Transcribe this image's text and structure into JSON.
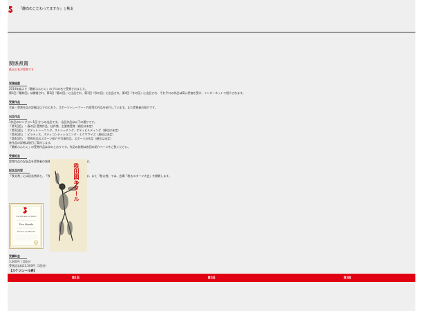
{
  "header": {
    "logo_icon": "brand-logo-icon",
    "title": "「趣向のこだわってますか」 | 秩太"
  },
  "main": {
    "title": "関係県賞",
    "subtitle": "秩太の名が受賞です",
    "sections": [
      {
        "heading": "受賞経歴",
        "lines": [
          "2014年度より『最新ぶんもく』のプロの名で受賞されました。",
          "第1回『最終回』は開催され、第2回『春の回』に出品され、第3回『秋の回』に出品され、第4回『冬の回』に出品され、それぞれの作品は高い評価を受け、インターネットで紹介されます。"
        ]
      },
      {
        "heading": "受賞作品",
        "lines": [
          "写真・受賞作品の詳細は以下のとおり、スポーツトレーナー・作家等の作品を紹介しています。また受賞者の紹介です。"
        ]
      },
      {
        "heading": "出品作品",
        "lines": [
          "1作品のロングラン1回 からの出品です。 出品作品は以下の通りです。",
          "「第1回目」：春の回 受賞作品、佳作賞、主要賞受賞（順位は未定）",
          "「第2回目」：ボディトレーニング、ストレッチング、ボディビルディング（順位は未定）",
          "「第3回目」：ピラティス、ボディコンディショニング・エクササイズ（順位は未定）",
          "「第4回目」：受賞作品のスポーツ紹介や写真作品、スポーツの作品（順位は未定）",
          "各作品の詳細は後日ご案内します。",
          "「最新ぶんもく」の受賞作品は次のとおりです。作品の詳細は各回の紹介ページをご覧ください。"
        ]
      },
      {
        "heading": "受賞記念",
        "lines": [
          "受賞作品の記念品を受賞者の皆様に「秩太賞」として贈呈します。"
        ]
      },
      {
        "heading": "記念品内容",
        "lines": [
          "「秩太賞」には記念賞状と、「秩太賞トロフィー」を贈呈します。また「秩太賞」では、会場「秩太スポーツ大会」を開催します。"
        ]
      }
    ],
    "certificate_lines": [
      "Certificate of Merit",
      "Tora Masaka",
      "Doctor of Muscle"
    ],
    "poster_caption": "秩田図キタール",
    "fee_heading": "受講料金",
    "fee_lines": [
      "3,000円（1回分）",
      "受賞記念料13,500円（1回分）"
    ],
    "schedule_label": "【スケジュール表】",
    "schedule_tabs": [
      "第1回",
      "第2回",
      "第3回"
    ]
  },
  "colors": {
    "background": "#efefef",
    "accent": "#e10012"
  }
}
